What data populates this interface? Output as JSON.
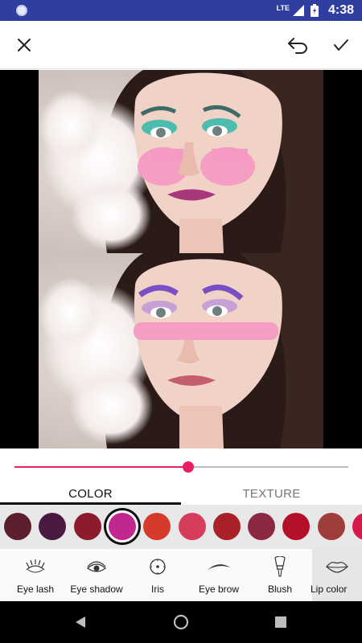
{
  "status_bar": {
    "network": "LTE",
    "time": "4:38"
  },
  "toolbar": {
    "close_icon": "close-icon",
    "undo_icon": "undo-icon",
    "confirm_icon": "check-icon"
  },
  "intensity": {
    "value": 0.52
  },
  "tabs": [
    {
      "label": "COLOR",
      "active": true
    },
    {
      "label": "TEXTURE",
      "active": false
    }
  ],
  "swatches": [
    {
      "color": "#5c1f2d",
      "selected": false
    },
    {
      "color": "#4a1940",
      "selected": false
    },
    {
      "color": "#8d1b2e",
      "selected": false
    },
    {
      "color": "#c2278e",
      "selected": true
    },
    {
      "color": "#d63a2d",
      "selected": false
    },
    {
      "color": "#d63d5d",
      "selected": false
    },
    {
      "color": "#a82127",
      "selected": false
    },
    {
      "color": "#8b2842",
      "selected": false
    },
    {
      "color": "#b5102a",
      "selected": false
    },
    {
      "color": "#9e3d3a",
      "selected": false
    },
    {
      "color": "#d61a4a",
      "selected": false
    }
  ],
  "categories": [
    {
      "label": "Eye lash",
      "icon": "eyelash-icon",
      "active": false
    },
    {
      "label": "Eye shadow",
      "icon": "eyeshadow-icon",
      "active": false
    },
    {
      "label": "Iris",
      "icon": "iris-icon",
      "active": false
    },
    {
      "label": "Eye brow",
      "icon": "eyebrow-icon",
      "active": false
    },
    {
      "label": "Blush",
      "icon": "blush-brush-icon",
      "active": false
    },
    {
      "label": "Lip color",
      "icon": "lips-icon",
      "active": true
    }
  ],
  "colors": {
    "accent": "#e91e63",
    "status_bar": "#303f9f"
  }
}
